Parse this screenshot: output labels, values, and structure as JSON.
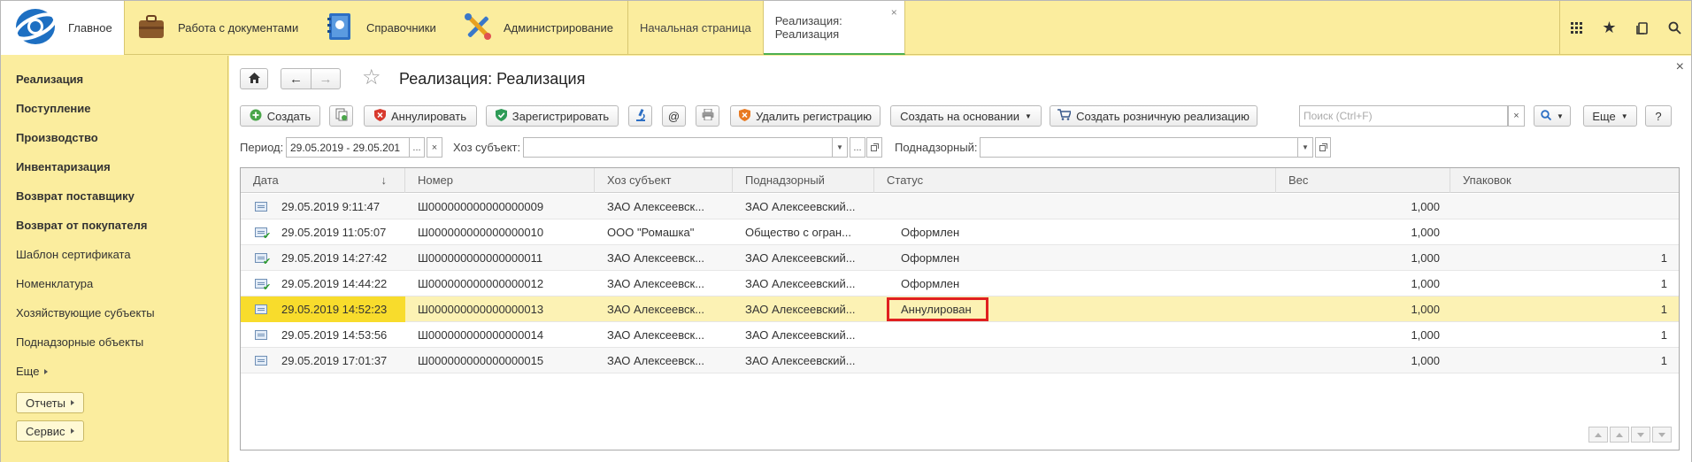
{
  "topbar": {
    "sections": [
      {
        "label": "Главное",
        "icon": "logo-icon"
      },
      {
        "label": "Работа с документами",
        "icon": "briefcase-icon"
      },
      {
        "label": "Справочники",
        "icon": "directory-icon"
      },
      {
        "label": "Администрирование",
        "icon": "tools-icon"
      }
    ],
    "open_tabs": [
      {
        "label": "Начальная страница"
      },
      {
        "label": "Реализация: Реализация",
        "close": "×"
      }
    ],
    "right_icons": [
      "apps-grid-icon",
      "favorites-star-icon",
      "history-icon",
      "search-icon"
    ]
  },
  "sidebar": {
    "items": [
      {
        "label": "Реализация",
        "bold": true
      },
      {
        "label": "Поступление",
        "bold": true
      },
      {
        "label": "Производство",
        "bold": true
      },
      {
        "label": "Инвентаризация",
        "bold": true
      },
      {
        "label": "Возврат поставщику",
        "bold": true
      },
      {
        "label": "Возврат от покупателя",
        "bold": true
      },
      {
        "label": "Шаблон сертификата",
        "bold": false
      },
      {
        "label": "Номенклатура",
        "bold": false
      },
      {
        "label": "Хозяйствующие субъекты",
        "bold": false
      },
      {
        "label": "Поднадзорные объекты",
        "bold": false
      }
    ],
    "more_label": "Еще",
    "reports_label": "Отчеты",
    "service_label": "Сервис"
  },
  "form": {
    "title": "Реализация: Реализация",
    "close": "×",
    "toolbar": {
      "create": "Создать",
      "annul": "Аннулировать",
      "register": "Зарегистрировать",
      "at": "@",
      "delete_registration": "Удалить регистрацию",
      "create_based_on": "Создать на основании",
      "create_retail": "Создать розничную реализацию",
      "search_placeholder": "Поиск (Ctrl+F)",
      "search_clear": "×",
      "more": "Еще",
      "help": "?"
    },
    "filters": {
      "period_label": "Период:",
      "period_value": "29.05.2019 - 29.05.201",
      "period_pick": "...",
      "period_clear": "×",
      "subject_label": "Хоз субъект:",
      "subject_value": "",
      "subject_pick": "...",
      "supervised_label": "Поднадзорный:",
      "supervised_value": ""
    }
  },
  "table": {
    "columns": [
      "Дата",
      "Номер",
      "Хоз субъект",
      "Поднадзорный",
      "Статус",
      "Вес",
      "Упаковок"
    ],
    "sort_indicator": "↓",
    "rows": [
      {
        "icon": "document-icon",
        "posted": false,
        "date": "29.05.2019 9:11:47",
        "number": "Ш000000000000000009",
        "subject": "ЗАО  Алексеевск...",
        "supervised": "ЗАО Алексеевский...",
        "status": "",
        "weight": "1,000",
        "packs": ""
      },
      {
        "icon": "document-posted-icon",
        "posted": true,
        "date": "29.05.2019 11:05:07",
        "number": "Ш000000000000000010",
        "subject": "ООО \"Ромашка\"",
        "supervised": "Общество с огран...",
        "status": "Оформлен",
        "weight": "1,000",
        "packs": ""
      },
      {
        "icon": "document-posted-icon",
        "posted": true,
        "date": "29.05.2019 14:27:42",
        "number": "Ш000000000000000011",
        "subject": "ЗАО  Алексеевск...",
        "supervised": "ЗАО Алексеевский...",
        "status": "Оформлен",
        "weight": "1,000",
        "packs": "1"
      },
      {
        "icon": "document-posted-icon",
        "posted": true,
        "date": "29.05.2019 14:44:22",
        "number": "Ш000000000000000012",
        "subject": "ЗАО  Алексеевск...",
        "supervised": "ЗАО Алексеевский...",
        "status": "Оформлен",
        "weight": "1,000",
        "packs": "1"
      },
      {
        "icon": "document-icon",
        "posted": false,
        "date": "29.05.2019 14:52:23",
        "number": "Ш000000000000000013",
        "subject": "ЗАО  Алексеевск...",
        "supervised": "ЗАО Алексеевский...",
        "status": "Аннулирован",
        "weight": "1,000",
        "packs": "1",
        "selected": true
      },
      {
        "icon": "document-icon",
        "posted": false,
        "date": "29.05.2019 14:53:56",
        "number": "Ш000000000000000014",
        "subject": "ЗАО  Алексеевск...",
        "supervised": "ЗАО Алексеевский...",
        "status": "",
        "weight": "1,000",
        "packs": "1"
      },
      {
        "icon": "document-icon",
        "posted": false,
        "date": "29.05.2019 17:01:37",
        "number": "Ш000000000000000015",
        "subject": "ЗАО  Алексеевск...",
        "supervised": "ЗАО Алексеевский...",
        "status": "",
        "weight": "1,000",
        "packs": "1"
      }
    ]
  },
  "colors": {
    "panel": "#fbed9e",
    "selected_row": "#fcf2b4",
    "selected_date": "#f8dc2c",
    "highlight_box": "#e02020"
  }
}
